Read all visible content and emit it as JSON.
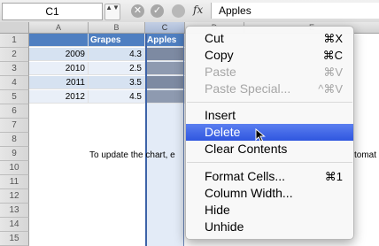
{
  "formula_bar": {
    "name_box": "C1",
    "arrows": "▲▼",
    "cancel_glyph": "✕",
    "enter_glyph": "✓",
    "fx_label": "fx",
    "value": "Apples"
  },
  "columns": [
    "A",
    "B",
    "C",
    "D",
    "E"
  ],
  "rows": [
    "1",
    "2",
    "3",
    "4",
    "5",
    "6",
    "7",
    "8",
    "9",
    "10",
    "11",
    "12",
    "13",
    "14",
    "15",
    "16",
    "17"
  ],
  "table": {
    "headers": [
      "",
      "Grapes",
      "Apples"
    ],
    "data": [
      {
        "year": "2009",
        "grapes": "4.3"
      },
      {
        "year": "2010",
        "grapes": "2.5"
      },
      {
        "year": "2011",
        "grapes": "3.5"
      },
      {
        "year": "2012",
        "grapes": "4.5"
      }
    ]
  },
  "note_text": "To update the chart, e",
  "note_tail": "tomat",
  "context_menu": {
    "items": [
      {
        "label": "Cut",
        "shortcut": "⌘X",
        "disabled": false
      },
      {
        "label": "Copy",
        "shortcut": "⌘C",
        "disabled": false
      },
      {
        "label": "Paste",
        "shortcut": "⌘V",
        "disabled": true
      },
      {
        "label": "Paste Special...",
        "shortcut": "^⌘V",
        "disabled": true
      },
      {
        "label": "Insert",
        "shortcut": "",
        "disabled": false
      },
      {
        "label": "Delete",
        "shortcut": "",
        "disabled": false,
        "highlighted": true
      },
      {
        "label": "Clear Contents",
        "shortcut": "",
        "disabled": false
      },
      {
        "label": "Format Cells...",
        "shortcut": "⌘1",
        "disabled": false
      },
      {
        "label": "Column Width...",
        "shortcut": "",
        "disabled": false
      },
      {
        "label": "Hide",
        "shortcut": "",
        "disabled": false
      },
      {
        "label": "Unhide",
        "shortcut": "",
        "disabled": false
      }
    ]
  },
  "colors": {
    "header_fill": "#4f7fc1",
    "highlight": "#3a5fe5",
    "selected_column": "#e3ebf7"
  }
}
